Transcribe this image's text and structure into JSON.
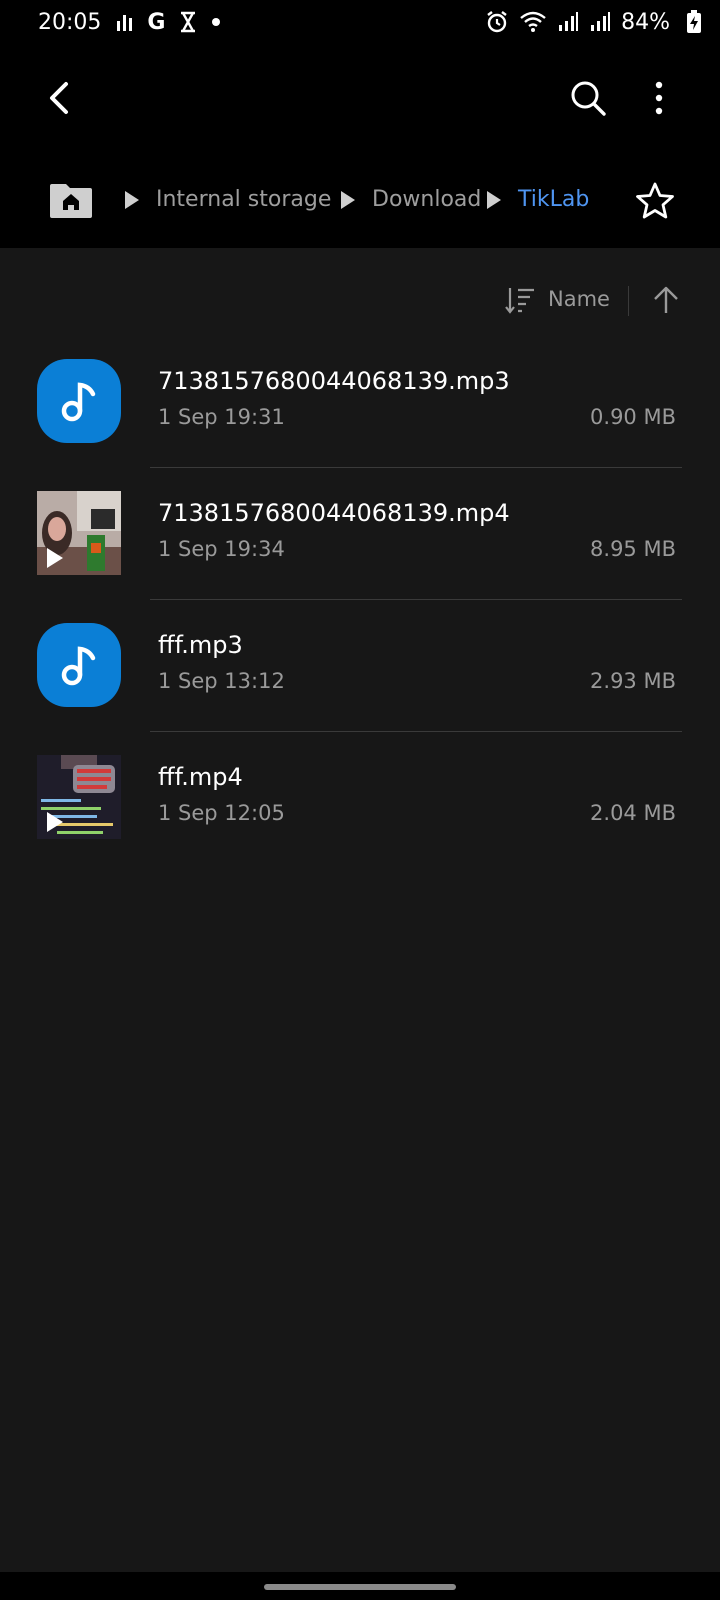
{
  "status_bar": {
    "time": "20:05",
    "carrier_badge": "G",
    "battery_percent": "84%"
  },
  "app_bar": {
    "back_icon": "back-arrow-icon",
    "search_icon": "search-icon",
    "more_icon": "more-vertical-icon"
  },
  "breadcrumb": {
    "home_icon": "home-folder-icon",
    "items": [
      {
        "label": "Internal storage"
      },
      {
        "label": "Download"
      },
      {
        "label": "TikLab"
      }
    ],
    "favorite_icon": "star-outline-icon",
    "active_color": "#4f95f1"
  },
  "sort": {
    "label": "Name",
    "sort_icon": "sort-icon",
    "direction_icon": "arrow-up-icon"
  },
  "files": [
    {
      "name": "7138157680044068139.mp3",
      "date": "1 Sep 19:31",
      "size": "0.90 MB",
      "type": "audio",
      "icon": "music-note-icon"
    },
    {
      "name": "7138157680044068139.mp4",
      "date": "1 Sep 19:34",
      "size": "8.95 MB",
      "type": "video",
      "icon": "play-icon"
    },
    {
      "name": "fff.mp3",
      "date": "1 Sep 13:12",
      "size": "2.93 MB",
      "type": "audio",
      "icon": "music-note-icon"
    },
    {
      "name": "fff.mp4",
      "date": "1 Sep 12:05",
      "size": "2.04 MB",
      "type": "video",
      "icon": "play-icon"
    }
  ],
  "colors": {
    "background": "#171717",
    "audio_icon_bg": "#0b7fd6"
  }
}
